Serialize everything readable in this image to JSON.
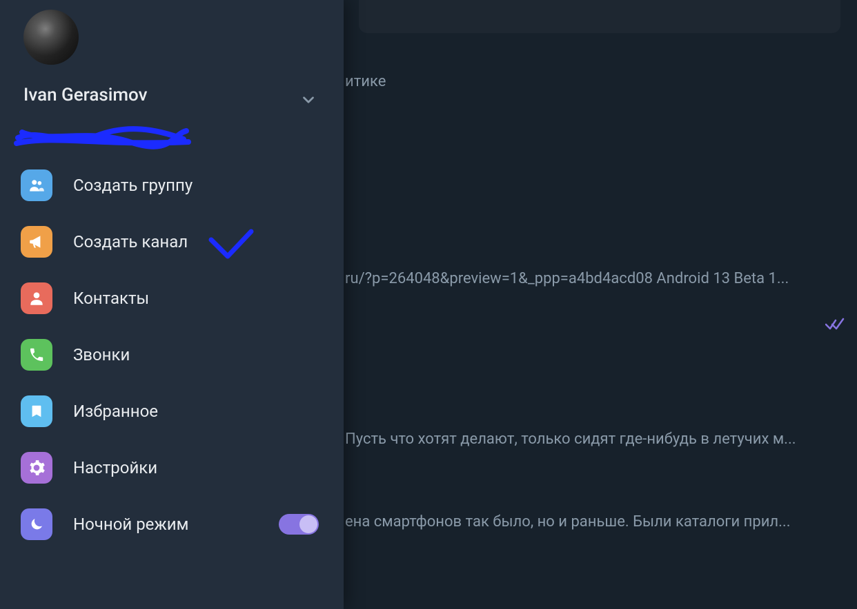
{
  "profile": {
    "name": "Ivan Gerasimov"
  },
  "menu": {
    "new_group": "Создать группу",
    "new_channel": "Создать канал",
    "contacts": "Контакты",
    "calls": "Звонки",
    "saved": "Избранное",
    "settings": "Настройки",
    "night_mode": "Ночной режим"
  },
  "night_mode_on": true,
  "chat": {
    "line1": "итике",
    "line2": "ru/?p=264048&preview=1&_ppp=a4bd4acd08  Android 13 Beta 1...",
    "line3": "Пусть что хотят делают, только сидят где-нибудь в летучих м...",
    "line4": "ена смартфонов  так было, но и раньше. Были каталоги прил..."
  },
  "colors": {
    "sidebar_bg": "#232e3c",
    "chat_bg": "#17212b",
    "accent": "#8774e1",
    "annotation": "#1b2bff"
  }
}
